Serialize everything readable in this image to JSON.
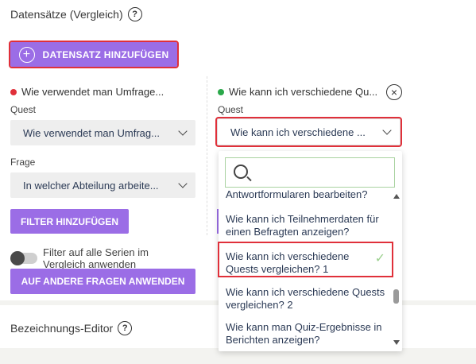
{
  "section": {
    "title": "Datensätze (Vergleich)",
    "help": "?"
  },
  "add_dataset_button": {
    "label": "DATENSATZ HINZUFÜGEN",
    "icon": "plus-circle-icon"
  },
  "series_left": {
    "title": "Wie verwendet man Umfrage...",
    "color": "#e0303a",
    "quest_label": "Quest",
    "quest_value": "Wie verwendet man Umfrag...",
    "question_label": "Frage",
    "question_value": "In welcher Abteilung arbeite...",
    "filter_button": "FILTER HINZUFÜGEN",
    "toggle_label": "Filter auf alle Serien im Vergleich anwenden",
    "toggle_on": false,
    "apply_button": "AUF ANDERE FRAGEN ANWENDEN"
  },
  "series_right": {
    "title": "Wie kann ich verschiedene Qu...",
    "color": "#2aa84a",
    "quest_label": "Quest",
    "quest_value": "Wie kann ich verschiedene ...",
    "close": "×"
  },
  "dropdown": {
    "search_placeholder": "",
    "items": [
      {
        "text": "Antwortformularen bearbeiten?",
        "selected": false
      },
      {
        "text": "Wie kann ich Teilnehmerdaten für einen Befragten anzeigen?",
        "selected": false
      },
      {
        "text": "Wie kann ich verschiedene Quests vergleichen? 1",
        "selected": true
      },
      {
        "text": "Wie kann ich verschiedene Quests vergleichen? 2",
        "selected": false
      },
      {
        "text": "Wie kann man Quiz-Ergebnisse in Berichten anzeigen?",
        "selected": false
      }
    ],
    "check_glyph": "✓"
  },
  "label_editor": {
    "title": "Bezeichnungs-Editor",
    "help": "?"
  },
  "colors": {
    "accent": "#9b6de6",
    "highlight": "#e0303a",
    "field_bg": "#eeeeee"
  }
}
